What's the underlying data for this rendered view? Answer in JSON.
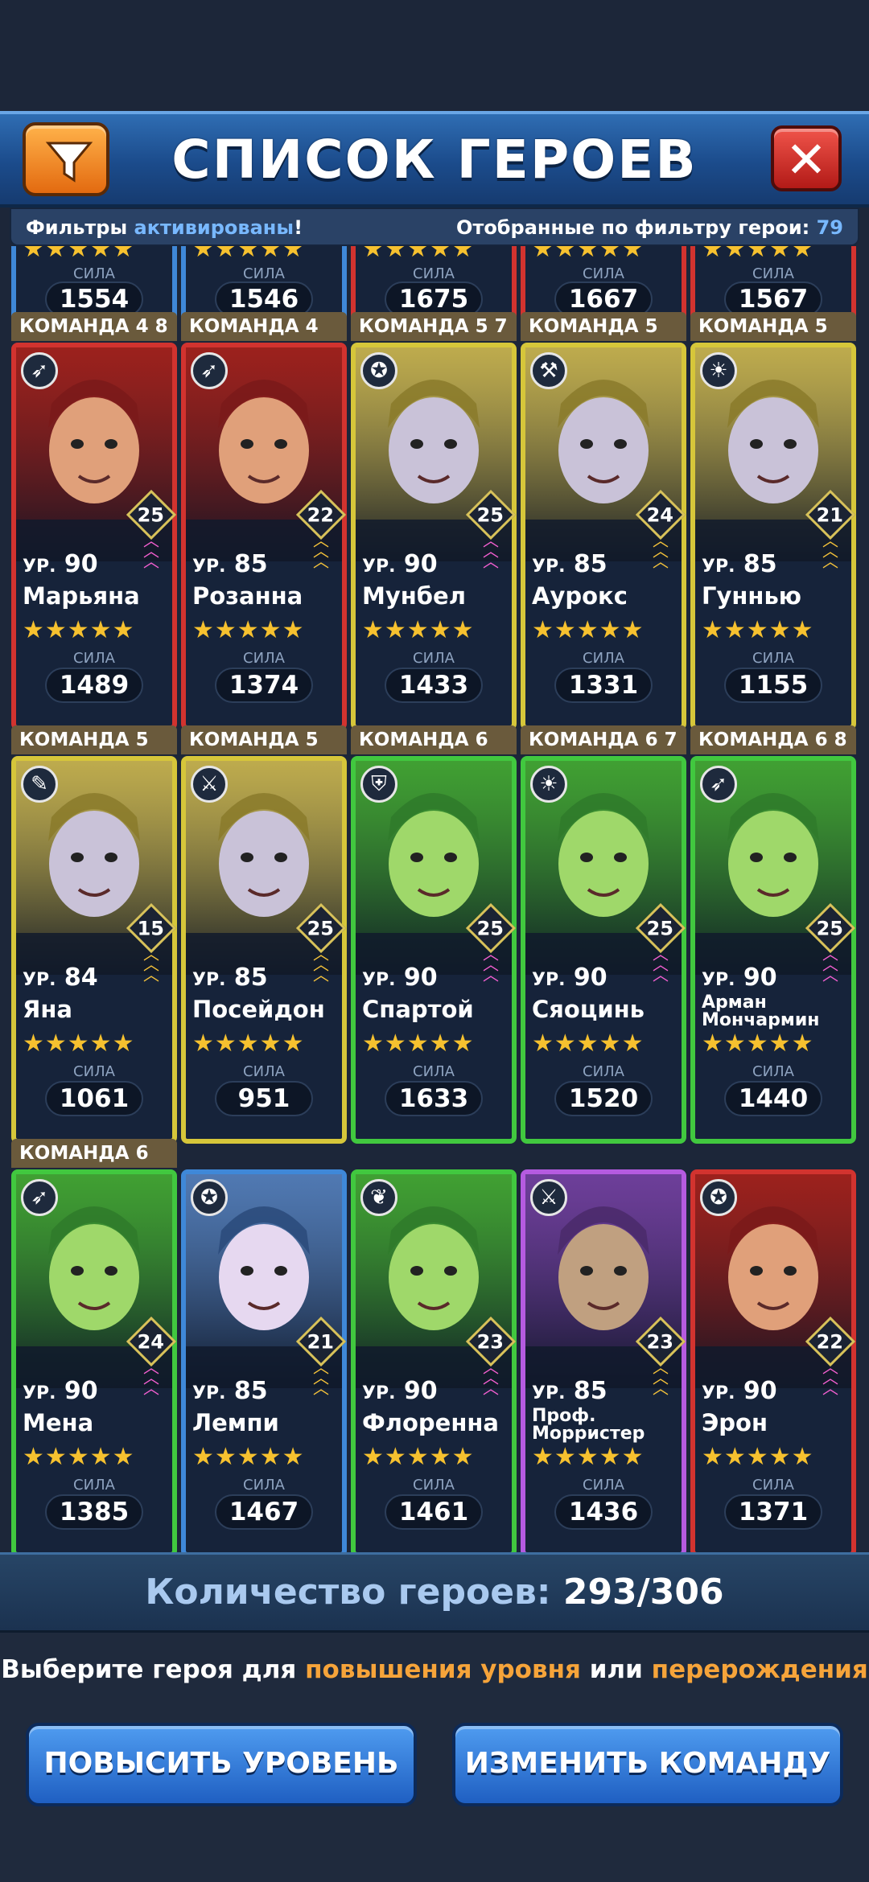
{
  "header": {
    "title": "СПИСОК ГЕРОЕВ",
    "close_symbol": "✕"
  },
  "filter_bar": {
    "left_prefix": "Фильтры",
    "left_accent": "активированы",
    "left_suffix": "!",
    "right_label": "Отобранные по фильтру герои:",
    "right_value": "79"
  },
  "top_row_partial": [
    {
      "stars": "★★★★★",
      "power_label": "СИЛА",
      "power": "1554",
      "frame": "blue"
    },
    {
      "stars": "★★★★★",
      "power_label": "СИЛА",
      "power": "1546",
      "frame": "blue"
    },
    {
      "stars": "★★★★★",
      "power_label": "СИЛА",
      "power": "1675",
      "frame": "red"
    },
    {
      "stars": "★★★★★",
      "power_label": "СИЛА",
      "power": "1667",
      "frame": "red"
    },
    {
      "stars": "★★★★★",
      "power_label": "СИЛА",
      "power": "1567",
      "frame": "red"
    }
  ],
  "heroes": [
    {
      "team": "КОМАНДА 4 8",
      "level_prefix": "УР.",
      "level": "90",
      "name": "Марьяна",
      "stars": "★★★★★",
      "power_label": "СИЛА",
      "power": "1489",
      "rank": "25",
      "frame": "red",
      "class_icon": "bow-icon",
      "chevron_color": "pink"
    },
    {
      "team": "КОМАНДА 4",
      "level_prefix": "УР.",
      "level": "85",
      "name": "Розанна",
      "stars": "★★★★★",
      "power_label": "СИЛА",
      "power": "1374",
      "rank": "22",
      "frame": "red",
      "class_icon": "bow-icon",
      "chevron_color": "gold"
    },
    {
      "team": "КОМАНДА 5 7",
      "level_prefix": "УР.",
      "level": "90",
      "name": "Мунбел",
      "stars": "★★★★★",
      "power_label": "СИЛА",
      "power": "1433",
      "rank": "25",
      "frame": "gold",
      "class_icon": "pentagram-icon",
      "chevron_color": "pink"
    },
    {
      "team": "КОМАНДА 5",
      "level_prefix": "УР.",
      "level": "85",
      "name": "Аурокс",
      "stars": "★★★★★",
      "power_label": "СИЛА",
      "power": "1331",
      "rank": "24",
      "frame": "gold",
      "class_icon": "axe-icon",
      "chevron_color": "gold"
    },
    {
      "team": "КОМАНДА 5",
      "level_prefix": "УР.",
      "level": "85",
      "name": "Гуннью",
      "stars": "★★★★★",
      "power_label": "СИЛА",
      "power": "1155",
      "rank": "21",
      "frame": "gold",
      "class_icon": "sun-icon",
      "chevron_color": "gold"
    },
    {
      "team": "КОМАНДА 5",
      "level_prefix": "УР.",
      "level": "84",
      "name": "Яна",
      "stars": "★★★★★",
      "power_label": "СИЛА",
      "power": "1061",
      "rank": "15",
      "frame": "gold",
      "class_icon": "book-icon",
      "chevron_color": "gold"
    },
    {
      "team": "КОМАНДА 5",
      "level_prefix": "УР.",
      "level": "85",
      "name": "Посейдон",
      "stars": "★★★★★",
      "power_label": "СИЛА",
      "power": "951",
      "rank": "25",
      "frame": "gold",
      "class_icon": "swords-icon",
      "chevron_color": "gold"
    },
    {
      "team": "КОМАНДА 6",
      "level_prefix": "УР.",
      "level": "90",
      "name": "Спартой",
      "stars": "★★★★★",
      "power_label": "СИЛА",
      "power": "1633",
      "rank": "25",
      "frame": "green",
      "class_icon": "shield-icon",
      "chevron_color": "pink"
    },
    {
      "team": "КОМАНДА 6 7",
      "level_prefix": "УР.",
      "level": "90",
      "name": "Сяоцинь",
      "stars": "★★★★★",
      "power_label": "СИЛА",
      "power": "1520",
      "rank": "25",
      "frame": "green",
      "class_icon": "sun-icon",
      "chevron_color": "pink"
    },
    {
      "team": "КОМАНДА 6 8",
      "level_prefix": "УР.",
      "level": "90",
      "name": "Арман Мончармин",
      "stars": "★★★★★",
      "power_label": "СИЛА",
      "power": "1440",
      "rank": "25",
      "frame": "green",
      "class_icon": "bow-icon",
      "chevron_color": "pink"
    },
    {
      "team": "КОМАНДА 6",
      "level_prefix": "УР.",
      "level": "90",
      "name": "Мена",
      "stars": "★★★★★",
      "power_label": "СИЛА",
      "power": "1385",
      "rank": "24",
      "frame": "green",
      "class_icon": "bow-icon",
      "chevron_color": "pink"
    },
    {
      "team": "",
      "level_prefix": "УР.",
      "level": "85",
      "name": "Лемпи",
      "stars": "★★★★★",
      "power_label": "СИЛА",
      "power": "1467",
      "rank": "21",
      "frame": "blue",
      "class_icon": "pentagram-icon",
      "chevron_color": "gold"
    },
    {
      "team": "",
      "level_prefix": "УР.",
      "level": "90",
      "name": "Флоренна",
      "stars": "★★★★★",
      "power_label": "СИЛА",
      "power": "1461",
      "rank": "23",
      "frame": "green",
      "class_icon": "leaf-icon",
      "chevron_color": "pink"
    },
    {
      "team": "",
      "level_prefix": "УР.",
      "level": "85",
      "name": "Проф. Морристер",
      "stars": "★★★★★",
      "power_label": "СИЛА",
      "power": "1436",
      "rank": "23",
      "frame": "purple",
      "class_icon": "swords-icon",
      "chevron_color": "gold"
    },
    {
      "team": "",
      "level_prefix": "УР.",
      "level": "90",
      "name": "Эрон",
      "stars": "★★★★★",
      "power_label": "СИЛА",
      "power": "1371",
      "rank": "22",
      "frame": "red",
      "class_icon": "pentagram-icon",
      "chevron_color": "pink"
    }
  ],
  "footer": {
    "count_label": "Количество героев:",
    "count_value": "293/306",
    "hint_prefix": "Выберите героя для",
    "hint_level": "повышения уровня",
    "hint_or": "или",
    "hint_rebirth": "перерождения",
    "level_up_button": "ПОВЫСИТЬ УРОВЕНЬ",
    "change_team_button": "ИЗМЕНИТЬ КОМАНДУ"
  },
  "colors": {
    "frame_red": "#d2332f",
    "frame_gold": "#d6c63a",
    "frame_green": "#41c83f",
    "frame_purple": "#b55be0",
    "frame_blue": "#3f88d8",
    "accent_orange": "#f6a43a"
  }
}
